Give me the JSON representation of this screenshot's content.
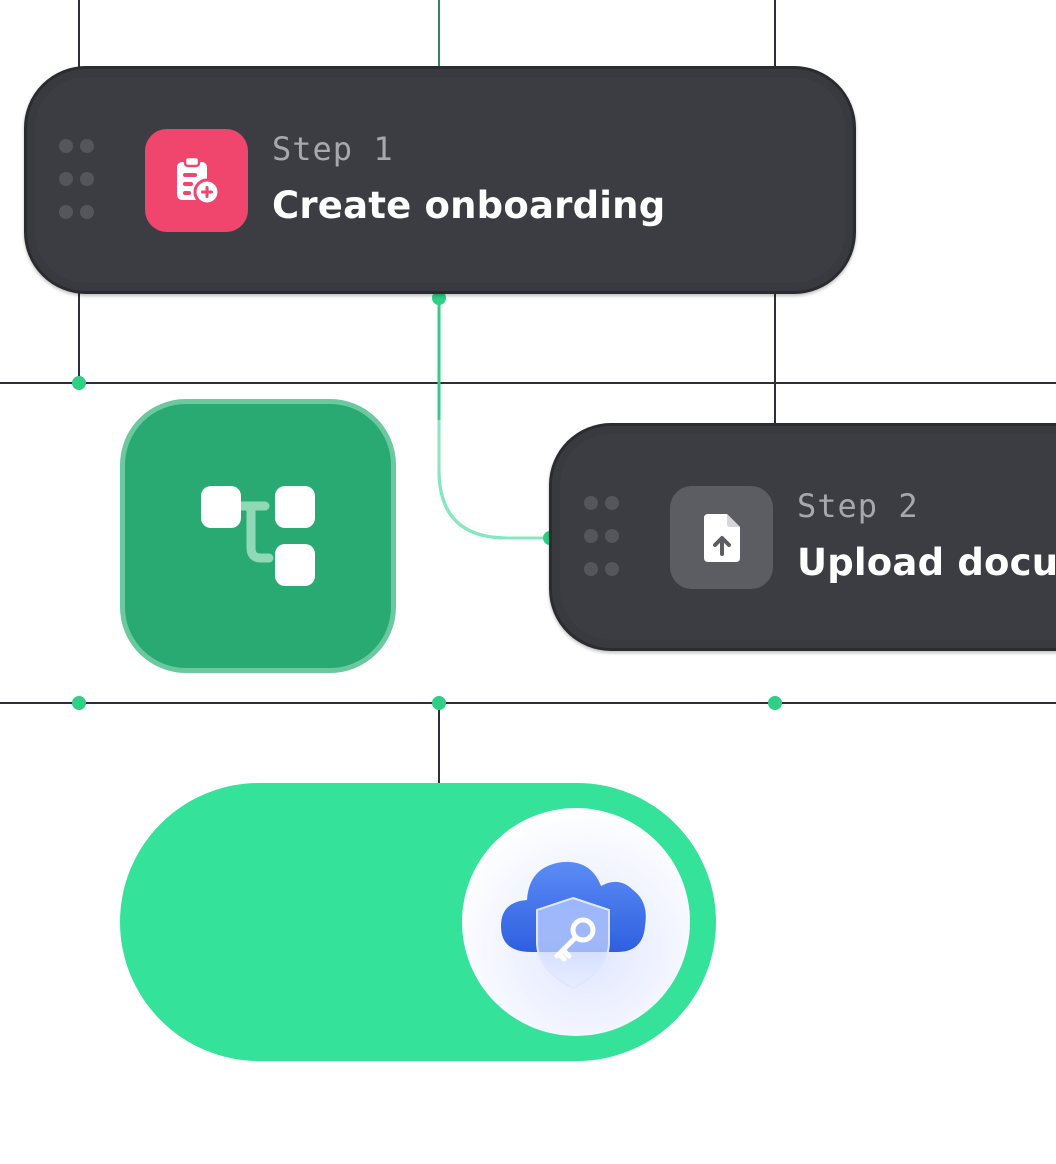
{
  "steps": [
    {
      "label": "Step 1",
      "title": "Create onboarding",
      "icon": "clipboard-plus-icon",
      "icon_color": "#f0466e"
    },
    {
      "label": "Step 2",
      "title": "Upload documents",
      "icon": "file-upload-icon",
      "icon_color": "#5c5d62"
    }
  ],
  "workflow_tile": {
    "icon": "workflow-branch-icon",
    "color": "#2aaa73"
  },
  "toggle": {
    "state": "on",
    "color": "#35e29a",
    "knob_icon": "cloud-key-shield-icon"
  },
  "colors": {
    "card": "#3c3d42",
    "grid_line": "#2f3035",
    "connector": "#2fcf86",
    "accent_light": "#7fe3b8"
  }
}
